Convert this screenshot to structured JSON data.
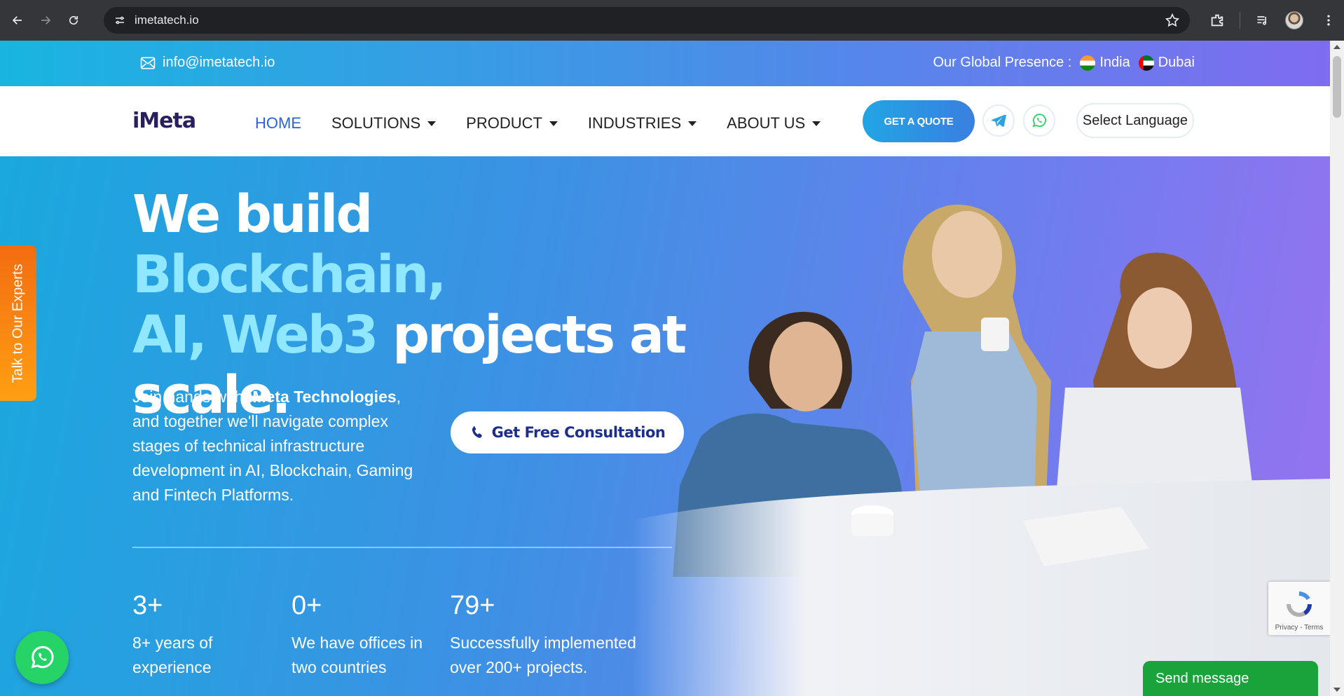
{
  "browser": {
    "url": "imetatech.io",
    "icons": [
      "back-icon",
      "forward-icon",
      "reload-icon",
      "site-info-icon",
      "star-icon",
      "extensions-icon",
      "media-icon",
      "profile-avatar",
      "menu-icon"
    ]
  },
  "topbar": {
    "email": "info@imetatech.io",
    "presence_label": "Our Global Presence :",
    "locations": [
      "India",
      "Dubai"
    ]
  },
  "header": {
    "logo": "iMeta",
    "menu": [
      {
        "label": "HOME",
        "active": true,
        "dropdown": false
      },
      {
        "label": "SOLUTIONS",
        "active": false,
        "dropdown": true
      },
      {
        "label": "PRODUCT",
        "active": false,
        "dropdown": true
      },
      {
        "label": "INDUSTRIES",
        "active": false,
        "dropdown": true
      },
      {
        "label": "ABOUT US",
        "active": false,
        "dropdown": true
      }
    ],
    "quote_button": "GET A QUOTE",
    "language": "Select Language"
  },
  "hero": {
    "headline": {
      "part1": "We build ",
      "part2": "Blockchain,",
      "part3": "AI, Web3",
      "part4": " projects at",
      "part5": "scale."
    },
    "intro_prefix": "Join hands with ",
    "intro_brand": "iMeta Technologies",
    "intro_suffix": ", and together we'll navigate complex stages of technical infrastructure development in AI, Blockchain, Gaming and Fintech Platforms.",
    "cta": "Get Free Consultation",
    "stats": [
      {
        "num": "3+",
        "label": "8+ years of experience"
      },
      {
        "num": "0+",
        "label": "We have offices in two countries"
      },
      {
        "num": "79+",
        "label": "Successfully implemented over 200+ projects."
      }
    ]
  },
  "widgets": {
    "talk_tab": "Talk to Our Experts",
    "recaptcha": "Privacy - Terms",
    "send_message": "Send message"
  },
  "colors": {
    "accent_cyan": "#8fe8ff",
    "brand_blue": "#2a64d8",
    "whatsapp_green": "#25d366",
    "tab_orange": "#f26c11"
  }
}
